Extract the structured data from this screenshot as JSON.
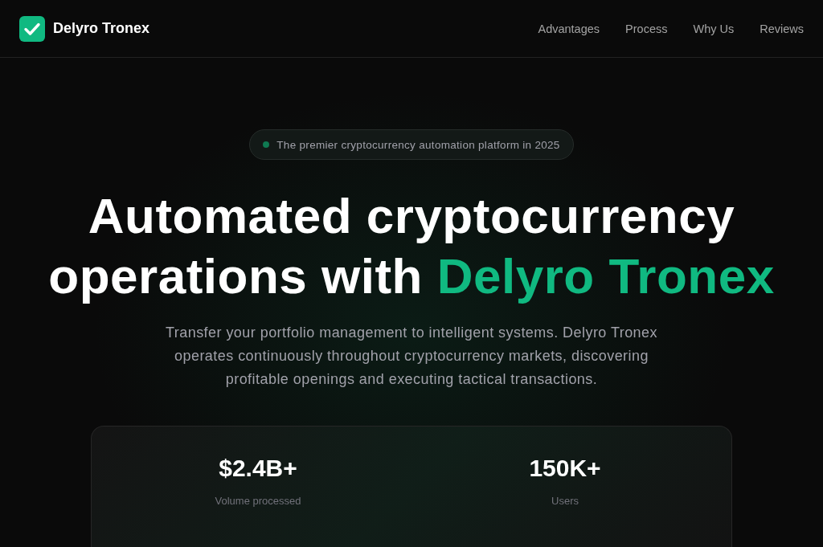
{
  "header": {
    "brand": {
      "name": "Delyro Tronex"
    },
    "nav": [
      {
        "label": "Advantages"
      },
      {
        "label": "Process"
      },
      {
        "label": "Why Us"
      },
      {
        "label": "Reviews"
      }
    ]
  },
  "hero": {
    "badge": {
      "text": "The premier cryptocurrency automation platform in 2025"
    },
    "heading": {
      "text": "Automated cryptocurrency operations with",
      "highlight": "Delyro Tronex"
    },
    "description": "Transfer your portfolio management to intelligent systems. Delyro Tronex operates continuously throughout cryptocurrency markets, discovering profitable openings and executing tactical transactions."
  },
  "stats": [
    {
      "value": "$2.4B+",
      "label": "Volume processed"
    },
    {
      "value": "150K+",
      "label": "Users"
    }
  ]
}
